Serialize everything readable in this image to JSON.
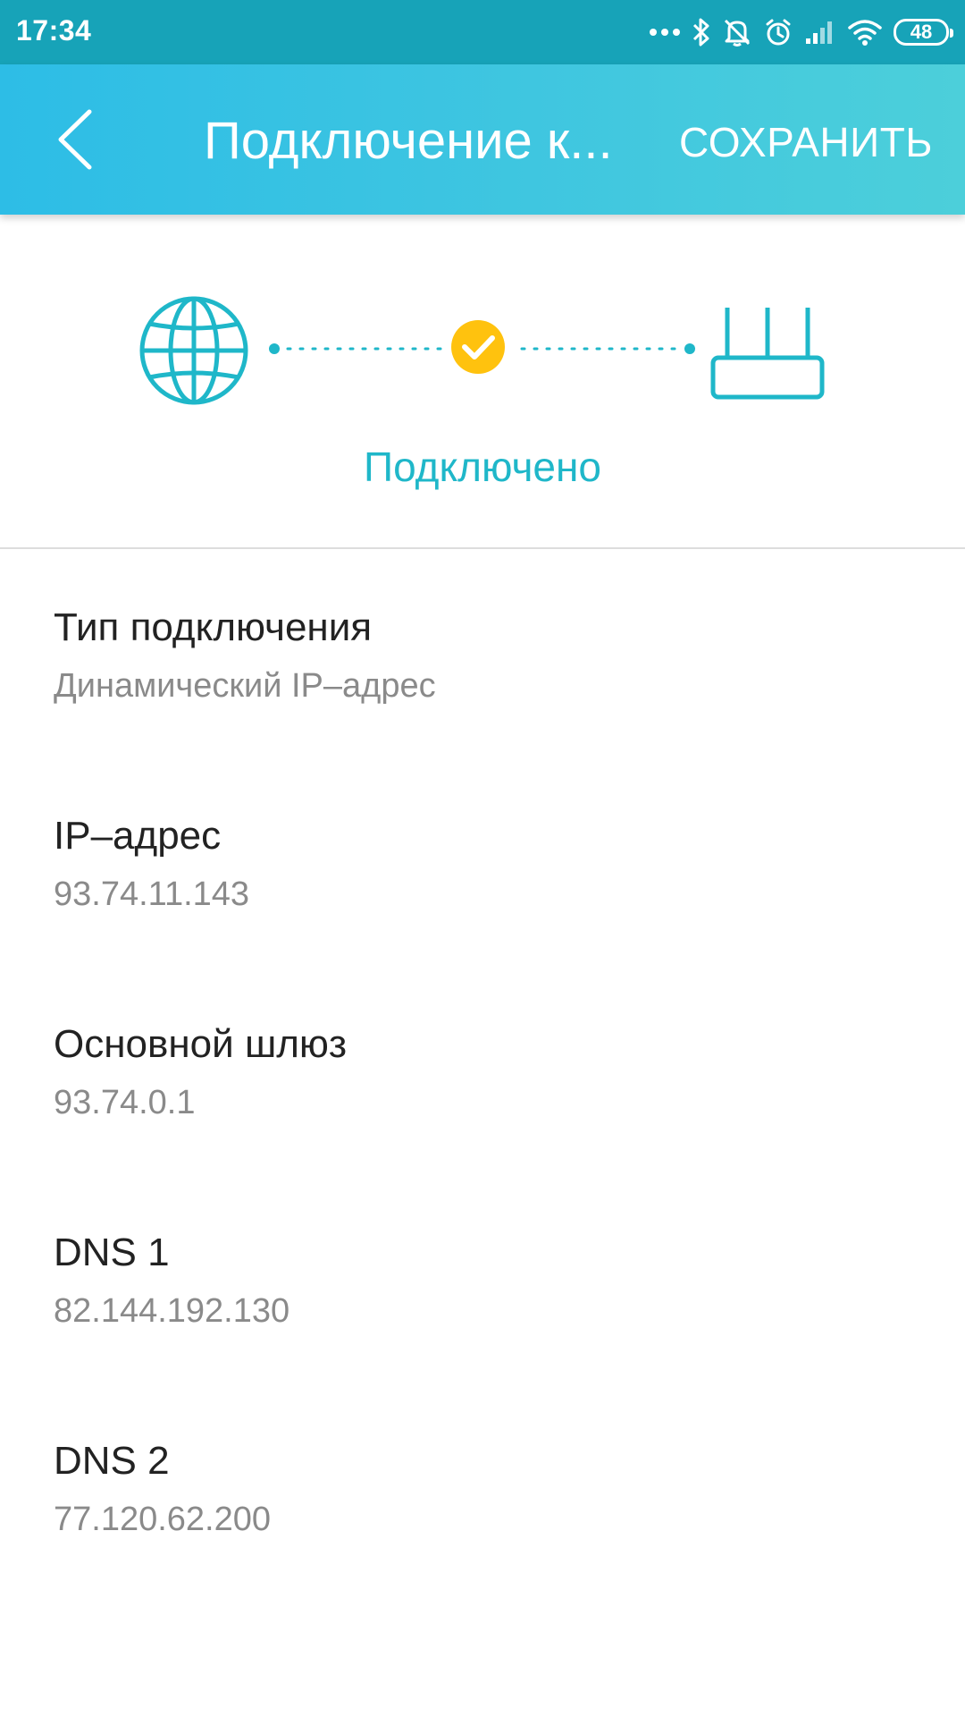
{
  "status_bar": {
    "time": "17:34",
    "battery": "48",
    "icons": [
      "more-dots-icon",
      "bluetooth-icon",
      "mute-icon",
      "alarm-icon",
      "signal-icon",
      "wifi-icon",
      "battery-icon"
    ]
  },
  "app_bar": {
    "title": "Подключение к...",
    "save_label": "СОХРАНИТЬ",
    "back_icon": "chevron-left-icon"
  },
  "connection": {
    "status": "Подключено",
    "icons": [
      "globe-icon",
      "check-icon",
      "router-icon"
    ]
  },
  "details": [
    {
      "label": "Тип подключения",
      "value": "Динамический IP–адрес"
    },
    {
      "label": "IP–адрес",
      "value": "93.74.11.143"
    },
    {
      "label": "Основной шлюз",
      "value": "93.74.0.1"
    },
    {
      "label": "DNS 1",
      "value": "82.144.192.130"
    },
    {
      "label": "DNS 2",
      "value": "77.120.62.200"
    }
  ],
  "colors": {
    "status_bar": "#17a3b8",
    "app_bar": "#3fc6e0",
    "accent": "#1fb7c9",
    "check": "#ffc20e"
  }
}
